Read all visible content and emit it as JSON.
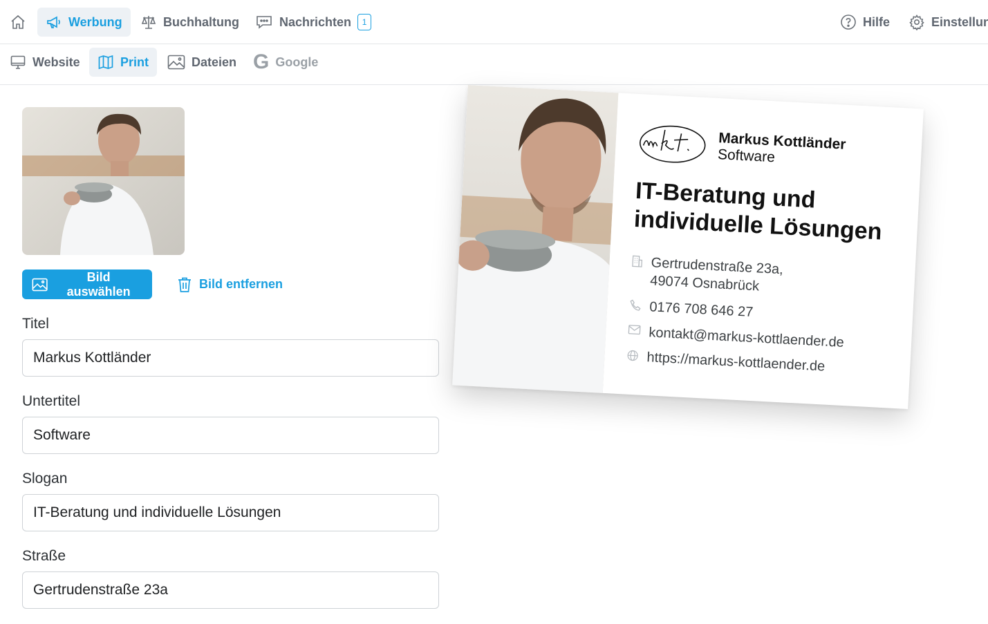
{
  "topnav": {
    "items": [
      {
        "label": "Werbung",
        "icon": "megaphone-icon",
        "active": true
      },
      {
        "label": "Buchhaltung",
        "icon": "scales-icon"
      },
      {
        "label": "Nachrichten",
        "icon": "chat-icon",
        "badge": "1"
      }
    ],
    "right": [
      {
        "label": "Hilfe",
        "icon": "help-icon"
      },
      {
        "label": "Einstellun",
        "icon": "gear-icon"
      }
    ]
  },
  "subnav": {
    "items": [
      {
        "label": "Website",
        "icon": "monitor-icon"
      },
      {
        "label": "Print",
        "icon": "map-icon",
        "active": true
      },
      {
        "label": "Dateien",
        "icon": "image-icon"
      },
      {
        "label": "Google",
        "icon": "google-icon",
        "glyph": "G"
      }
    ]
  },
  "image_actions": {
    "select": "Bild auswählen",
    "remove": "Bild entfernen"
  },
  "form": {
    "fields": [
      {
        "label": "Titel",
        "value": "Markus Kottländer"
      },
      {
        "label": "Untertitel",
        "value": "Software"
      },
      {
        "label": "Slogan",
        "value": "IT-Beratung und individuelle Lösungen"
      },
      {
        "label": "Straße",
        "value": "Gertrudenstraße 23a"
      }
    ]
  },
  "card": {
    "name": "Markus Kottländer",
    "subtitle": "Software",
    "slogan": "IT-Beratung und individuelle Lösungen",
    "address_line1": "Gertrudenstraße 23a,",
    "address_line2": "49074 Osnabrück",
    "phone": "0176 708 646 27",
    "email": "kontakt@markus-kottlaender.de",
    "url": "https://markus-kottlaender.de"
  },
  "colors": {
    "accent": "#1a9fe0",
    "active_bg": "#edf1f5",
    "nav_text": "#5f6670",
    "border": "#ced2d6"
  }
}
